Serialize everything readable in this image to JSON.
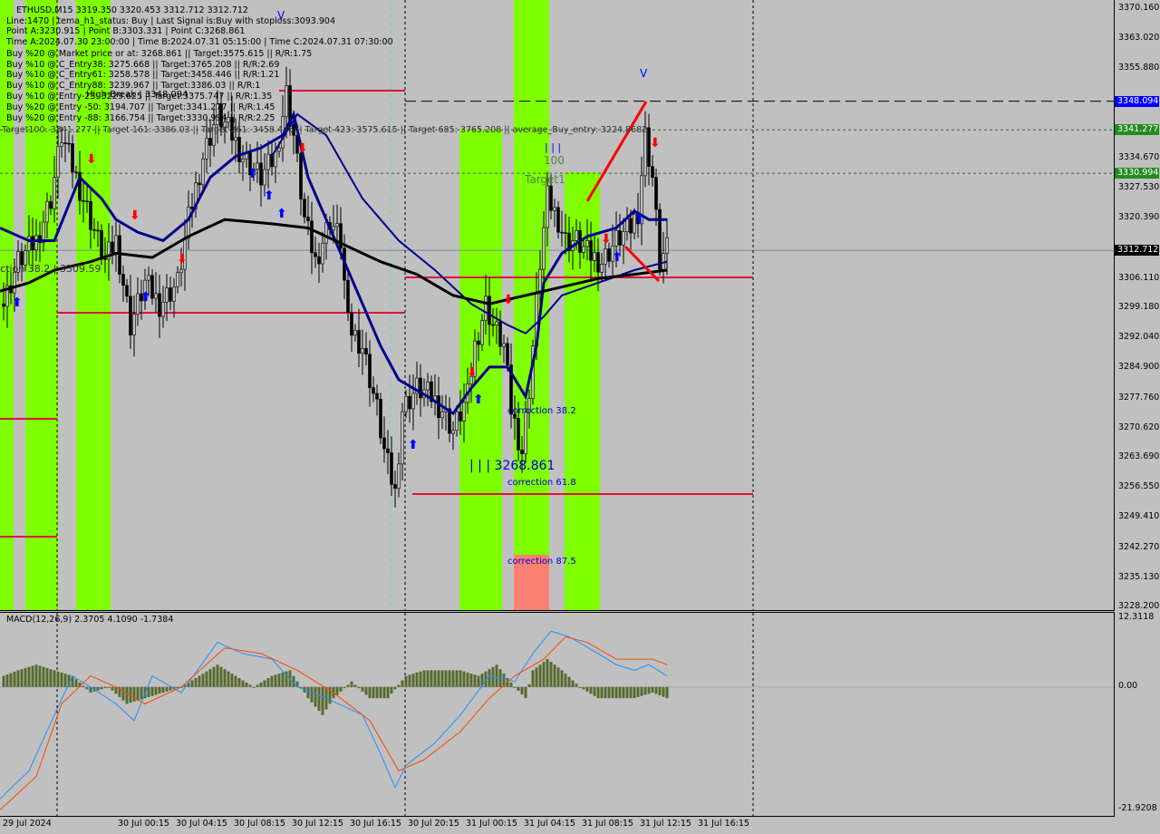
{
  "header": {
    "symbol_line": "ETHUSD,M15  3319.350 3320.453 3312.712 3312.712",
    "lines": [
      "Line:1470 | tema_h1_status: Buy | Last Signal is:Buy with stoploss:3093.904",
      "Point A:3230.915 | Point B:3303.331 | Point C:3268.861",
      "Time A:2024.07.30 23:00:00 | Time B:2024.07.31 05:15:00 | Time C:2024.07.31 07:30:00",
      "Buy %20 @ Market price or at: 3268.861 || Target:3575.615 || R/R:1.75",
      "Buy %10 @ C_Entry38: 3275.668 || Target:3765.208 || R/R:2.69",
      "Buy %10 @ C_Entry61: 3258.578 || Target:3458.446 || R/R:1.21",
      "Buy %10 @ C_Entry88: 3239.967 || Target:3386.03 || R/R:1",
      "Buy %10 @ Entry-23: 3229.625 || Target:3375.747 || R/R:1.35",
      "Buy %20 @ Entry -50: 3194.707 || Target:3341.277 || R/R:1.45",
      "Buy %20 @ Entry -88: 3166.754 || Target:3330.994 || R/R:2.25"
    ],
    "targets_line": "Target100: 3341.277 || Target 161: 3386.03 || Target 261: 3458.446 || Target 423: 3575.615 || Target 685: 3765.208 || average_Buy_entry: 3224.8682"
  },
  "annotations": {
    "high_break": "High-Break | 3348.094",
    "correction_left": "correction 38.2 | 3309.59",
    "correction_38": "correction 38.2",
    "correction_61": "correction 61.8",
    "correction_87": "correction 87.5",
    "point_c": "| | | 3268.861",
    "target1": "Target1",
    "hundred": "100",
    "bars": "| | |",
    "v_top1": "V",
    "v_top2": "V"
  },
  "price_axis": {
    "labels": [
      "3370.160",
      "3363.020",
      "3355.880",
      "3334.670",
      "3327.530",
      "3320.390",
      "3306.110",
      "3299.180",
      "3292.040",
      "3284.900",
      "3277.760",
      "3270.620",
      "3263.690",
      "3256.550",
      "3249.410",
      "3242.270",
      "3235.130",
      "3228.200"
    ],
    "tags": [
      {
        "value": "3348.094",
        "color": "#0000ff"
      },
      {
        "value": "3341.277",
        "color": "#228b22"
      },
      {
        "value": "3330.994",
        "color": "#228b22"
      },
      {
        "value": "3312.712",
        "color": "#000000"
      }
    ]
  },
  "macd": {
    "title": "MACD(12,26,9) 2.3705 4.1090 -1.7384",
    "axis_labels": [
      "12.3118",
      "0.00",
      "-21.9208"
    ]
  },
  "time_axis": [
    "29 Jul 2024",
    "30 Jul 00:15",
    "30 Jul 04:15",
    "30 Jul 08:15",
    "30 Jul 12:15",
    "30 Jul 16:15",
    "30 Jul 20:15",
    "31 Jul 00:15",
    "31 Jul 04:15",
    "31 Jul 08:15",
    "31 Jul 12:15",
    "31 Jul 16:15"
  ],
  "colors": {
    "background": "#c0c0c0",
    "zone": "#7fff00",
    "zone_loss": "#fa8072",
    "level": "#dc143c",
    "ma_fast": "#00008b",
    "ma_slow": "#000000",
    "macd": "#1e90ff",
    "signal": "#ff4500",
    "hist": "#556b2f"
  },
  "chart_data": {
    "type": "candlestick",
    "ylim": [
      3228.2,
      3370.16
    ],
    "price_keypoints_bar_close": [
      [
        1,
        3300
      ],
      [
        5,
        3310
      ],
      [
        10,
        3315
      ],
      [
        14,
        3325
      ],
      [
        17,
        3340
      ],
      [
        21,
        3330
      ],
      [
        25,
        3320
      ],
      [
        29,
        3310
      ],
      [
        32,
        3315
      ],
      [
        36,
        3295
      ],
      [
        40,
        3305
      ],
      [
        44,
        3300
      ],
      [
        49,
        3305
      ],
      [
        52,
        3320
      ],
      [
        56,
        3335
      ],
      [
        60,
        3345
      ],
      [
        64,
        3340
      ],
      [
        67,
        3335
      ],
      [
        72,
        3330
      ],
      [
        76,
        3335
      ],
      [
        79,
        3350
      ],
      [
        81,
        3340
      ],
      [
        84,
        3320
      ],
      [
        87,
        3310
      ],
      [
        91,
        3320
      ],
      [
        94,
        3315
      ],
      [
        96,
        3295
      ],
      [
        100,
        3290
      ],
      [
        104,
        3275
      ],
      [
        106,
        3265
      ],
      [
        109,
        3255
      ],
      [
        111,
        3275
      ],
      [
        115,
        3280
      ],
      [
        119,
        3278
      ],
      [
        122,
        3275
      ],
      [
        125,
        3270
      ],
      [
        129,
        3278
      ],
      [
        131,
        3290
      ],
      [
        134,
        3300
      ],
      [
        136,
        3295
      ],
      [
        139,
        3290
      ],
      [
        141,
        3275
      ],
      [
        144,
        3265
      ],
      [
        146,
        3280
      ],
      [
        149,
        3310
      ],
      [
        151,
        3325
      ],
      [
        154,
        3320
      ],
      [
        156,
        3315
      ],
      [
        159,
        3315
      ],
      [
        162,
        3312
      ],
      [
        166,
        3310
      ],
      [
        170,
        3315
      ],
      [
        174,
        3318
      ],
      [
        176,
        3322
      ],
      [
        178,
        3340
      ],
      [
        180,
        3330
      ],
      [
        182,
        3310
      ],
      [
        184,
        3312.712
      ]
    ],
    "ma_black": [
      [
        0,
        3303
      ],
      [
        8,
        3305
      ],
      [
        15,
        3308
      ],
      [
        25,
        3310
      ],
      [
        32,
        3312
      ],
      [
        42,
        3311
      ],
      [
        52,
        3316
      ],
      [
        62,
        3320
      ],
      [
        75,
        3319
      ],
      [
        85,
        3318
      ],
      [
        95,
        3314
      ],
      [
        105,
        3310
      ],
      [
        115,
        3307
      ],
      [
        125,
        3302
      ],
      [
        135,
        3300
      ],
      [
        145,
        3302
      ],
      [
        155,
        3304
      ],
      [
        165,
        3306
      ],
      [
        175,
        3307
      ],
      [
        184,
        3308
      ]
    ],
    "ma_fast": [
      [
        0,
        3318
      ],
      [
        8,
        3315
      ],
      [
        15,
        3315
      ],
      [
        22,
        3330
      ],
      [
        28,
        3325
      ],
      [
        32,
        3320
      ],
      [
        38,
        3317
      ],
      [
        45,
        3315
      ],
      [
        52,
        3320
      ],
      [
        58,
        3330
      ],
      [
        65,
        3335
      ],
      [
        72,
        3337
      ],
      [
        78,
        3340
      ],
      [
        81,
        3345
      ],
      [
        85,
        3330
      ],
      [
        90,
        3320
      ],
      [
        95,
        3310
      ],
      [
        100,
        3300
      ],
      [
        105,
        3290
      ],
      [
        110,
        3282
      ],
      [
        118,
        3278
      ],
      [
        125,
        3274
      ],
      [
        130,
        3280
      ],
      [
        135,
        3285
      ],
      [
        140,
        3285
      ],
      [
        145,
        3278
      ],
      [
        148,
        3290
      ],
      [
        150,
        3305
      ],
      [
        155,
        3312
      ],
      [
        162,
        3316
      ],
      [
        170,
        3318
      ],
      [
        175,
        3322
      ],
      [
        179,
        3320
      ],
      [
        184,
        3320
      ]
    ],
    "ma_slow": [
      [
        75,
        3335
      ],
      [
        82,
        3345
      ],
      [
        90,
        3340
      ],
      [
        100,
        3325
      ],
      [
        110,
        3315
      ],
      [
        120,
        3308
      ],
      [
        130,
        3300
      ],
      [
        140,
        3295
      ],
      [
        145,
        3293
      ],
      [
        150,
        3297
      ],
      [
        155,
        3302
      ],
      [
        165,
        3305
      ],
      [
        175,
        3308
      ],
      [
        184,
        3310
      ]
    ],
    "macd_hist": [
      [
        1,
        2
      ],
      [
        5,
        3
      ],
      [
        10,
        4
      ],
      [
        15,
        3
      ],
      [
        20,
        2
      ],
      [
        25,
        -1
      ],
      [
        30,
        0
      ],
      [
        35,
        -3
      ],
      [
        40,
        -2
      ],
      [
        45,
        -1
      ],
      [
        50,
        0
      ],
      [
        55,
        2
      ],
      [
        60,
        4
      ],
      [
        65,
        2
      ],
      [
        70,
        0
      ],
      [
        75,
        2
      ],
      [
        80,
        3
      ],
      [
        85,
        -2
      ],
      [
        89,
        -5
      ],
      [
        92,
        -2
      ],
      [
        97,
        1
      ],
      [
        102,
        -2
      ],
      [
        107,
        -2
      ],
      [
        112,
        2
      ],
      [
        117,
        3
      ],
      [
        122,
        3
      ],
      [
        127,
        3
      ],
      [
        132,
        2
      ],
      [
        137,
        4
      ],
      [
        142,
        0
      ],
      [
        145,
        -2
      ],
      [
        147,
        3
      ],
      [
        151,
        5
      ],
      [
        155,
        3
      ],
      [
        160,
        0
      ],
      [
        165,
        -2
      ],
      [
        170,
        -2
      ],
      [
        175,
        -2
      ],
      [
        180,
        -1
      ],
      [
        184,
        -2
      ]
    ],
    "macd_line": [
      [
        0,
        -20
      ],
      [
        8,
        -15
      ],
      [
        15,
        -5
      ],
      [
        20,
        2
      ],
      [
        25,
        0
      ],
      [
        32,
        -3
      ],
      [
        37,
        -6
      ],
      [
        42,
        2
      ],
      [
        50,
        -1
      ],
      [
        60,
        8
      ],
      [
        67,
        6
      ],
      [
        75,
        5
      ],
      [
        82,
        0
      ],
      [
        90,
        -2
      ],
      [
        100,
        -5
      ],
      [
        105,
        -12
      ],
      [
        109,
        -18
      ],
      [
        112,
        -14
      ],
      [
        120,
        -10
      ],
      [
        127,
        -5
      ],
      [
        135,
        2
      ],
      [
        142,
        1
      ],
      [
        147,
        6
      ],
      [
        152,
        10
      ],
      [
        157,
        9
      ],
      [
        165,
        6
      ],
      [
        170,
        4
      ],
      [
        175,
        3
      ],
      [
        179,
        4
      ],
      [
        184,
        2
      ]
    ],
    "signal_line": [
      [
        0,
        -22
      ],
      [
        10,
        -16
      ],
      [
        17,
        -3
      ],
      [
        25,
        2
      ],
      [
        32,
        0
      ],
      [
        40,
        -3
      ],
      [
        50,
        0
      ],
      [
        62,
        7
      ],
      [
        72,
        6
      ],
      [
        82,
        3
      ],
      [
        92,
        -1
      ],
      [
        102,
        -6
      ],
      [
        110,
        -15
      ],
      [
        117,
        -13
      ],
      [
        127,
        -8
      ],
      [
        135,
        -2
      ],
      [
        142,
        2
      ],
      [
        150,
        5
      ],
      [
        156,
        9
      ],
      [
        162,
        8
      ],
      [
        170,
        5
      ],
      [
        180,
        5
      ],
      [
        184,
        4
      ]
    ],
    "macd_ylim": [
      -21.9208,
      12.3118
    ]
  }
}
